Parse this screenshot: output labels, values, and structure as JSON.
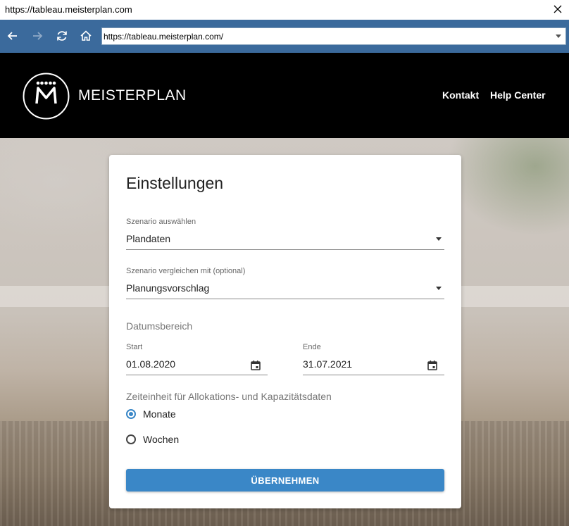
{
  "window": {
    "title": "https://tableau.meisterplan.com",
    "close_icon": "close-icon"
  },
  "browser": {
    "url": "https://tableau.meisterplan.com/",
    "icons": [
      "back-arrow-icon",
      "forward-arrow-icon",
      "refresh-icon",
      "home-icon",
      "chevron-down-icon"
    ],
    "toolbar_color": "#3b6a9c"
  },
  "header": {
    "brand": "MEISTERPLAN",
    "nav": [
      {
        "label": "Kontakt"
      },
      {
        "label": "Help Center"
      }
    ],
    "background": "#000000"
  },
  "settings": {
    "title": "Einstellungen",
    "scenario": {
      "label": "Szenario auswählen",
      "value": "Plandaten"
    },
    "compare": {
      "label": "Szenario vergleichen mit (optional)",
      "value": "Planungsvorschlag"
    },
    "date_range": {
      "heading": "Datumsbereich",
      "start_label": "Start",
      "start_value": "01.08.2020",
      "end_label": "Ende",
      "end_value": "31.07.2021"
    },
    "time_unit": {
      "heading": "Zeiteinheit für Allokations- und Kapazitätsdaten",
      "options": [
        {
          "label": "Monate",
          "selected": true
        },
        {
          "label": "Wochen",
          "selected": false
        }
      ]
    },
    "apply_label": "ÜBERNEHMEN",
    "accent": "#3a87c7"
  }
}
